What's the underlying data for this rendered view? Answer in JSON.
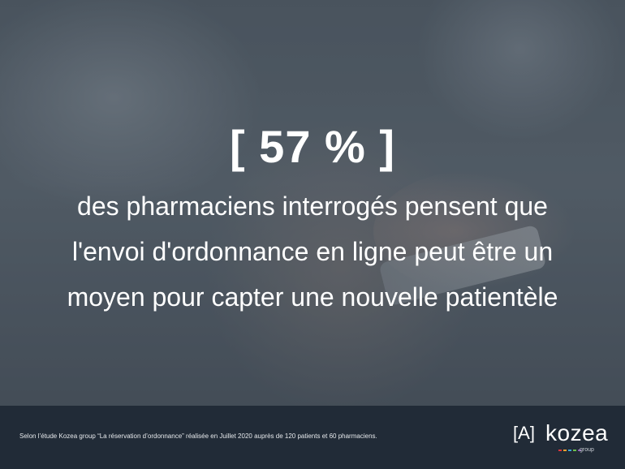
{
  "headline": "[ 57 % ]",
  "body_lines": [
    "des pharmaciens interrogés pensent que",
    "l'envoi d'ordonnance en ligne peut être un",
    "moyen pour capter une nouvelle patientèle"
  ],
  "footer": {
    "source": "Selon l’étude Kozea group “La réservation d’ordonnance” réalisée en Juillet 2020 auprès de 120 patients et 60 pharmaciens.",
    "logo_mark": "A",
    "logo_name": "kozea",
    "logo_sub": "group",
    "dot_colors": [
      "#e0353d",
      "#f0a12c",
      "#3aa6d9",
      "#6cbf4b",
      "#8a5bb3"
    ]
  },
  "colors": {
    "footer_bg": "#212b37",
    "text": "#ffffff"
  }
}
